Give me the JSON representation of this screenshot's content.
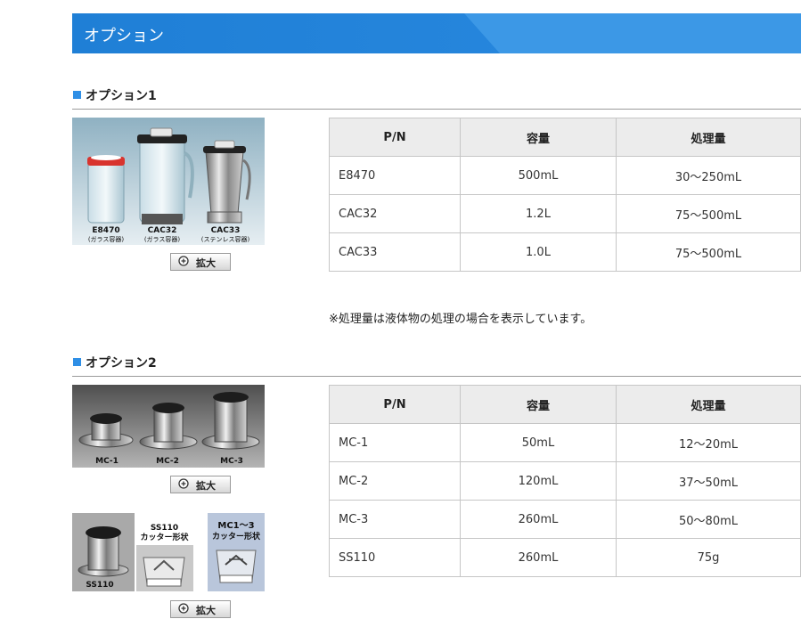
{
  "banner": {
    "title": "オプション"
  },
  "sections": [
    {
      "heading": "オプション1",
      "photo_labels": [
        {
          "code": "E8470",
          "sub": "(ガラス容器)"
        },
        {
          "code": "CAC32",
          "sub": "(ガラス容器)"
        },
        {
          "code": "CAC33",
          "sub": "(ステンレス容器)"
        }
      ],
      "zoom_label": "拡大",
      "table": {
        "headers": [
          "P/N",
          "容量",
          "処理量"
        ],
        "rows": [
          [
            "E8470",
            "500mL",
            "30～250mL"
          ],
          [
            "CAC32",
            "1.2L",
            "75～500mL"
          ],
          [
            "CAC33",
            "1.0L",
            "75～500mL"
          ]
        ]
      },
      "note": "※処理量は液体物の処理の場合を表示しています。"
    },
    {
      "heading": "オプション2",
      "photo_labels": [
        "MC-1",
        "MC-2",
        "MC-3"
      ],
      "photo2_labels": {
        "ss": "SS110",
        "ss_cutter_code": "SS110",
        "ss_cutter_sub": "カッター形状",
        "mc_cutter_code": "MC1～3",
        "mc_cutter_sub": "カッター形状"
      },
      "zoom_label": "拡大",
      "zoom_label_2": "拡大",
      "table": {
        "headers": [
          "P/N",
          "容量",
          "処理量"
        ],
        "rows": [
          [
            "MC-1",
            "50mL",
            "12～20mL"
          ],
          [
            "MC-2",
            "120mL",
            "37～50mL"
          ],
          [
            "MC-3",
            "260mL",
            "50～80mL"
          ],
          [
            "SS110",
            "260mL",
            "75g"
          ]
        ]
      }
    }
  ],
  "colors": {
    "banner": "#1f7fd6",
    "accent_square": "#2f8fe6",
    "header_bg": "#ececec"
  }
}
